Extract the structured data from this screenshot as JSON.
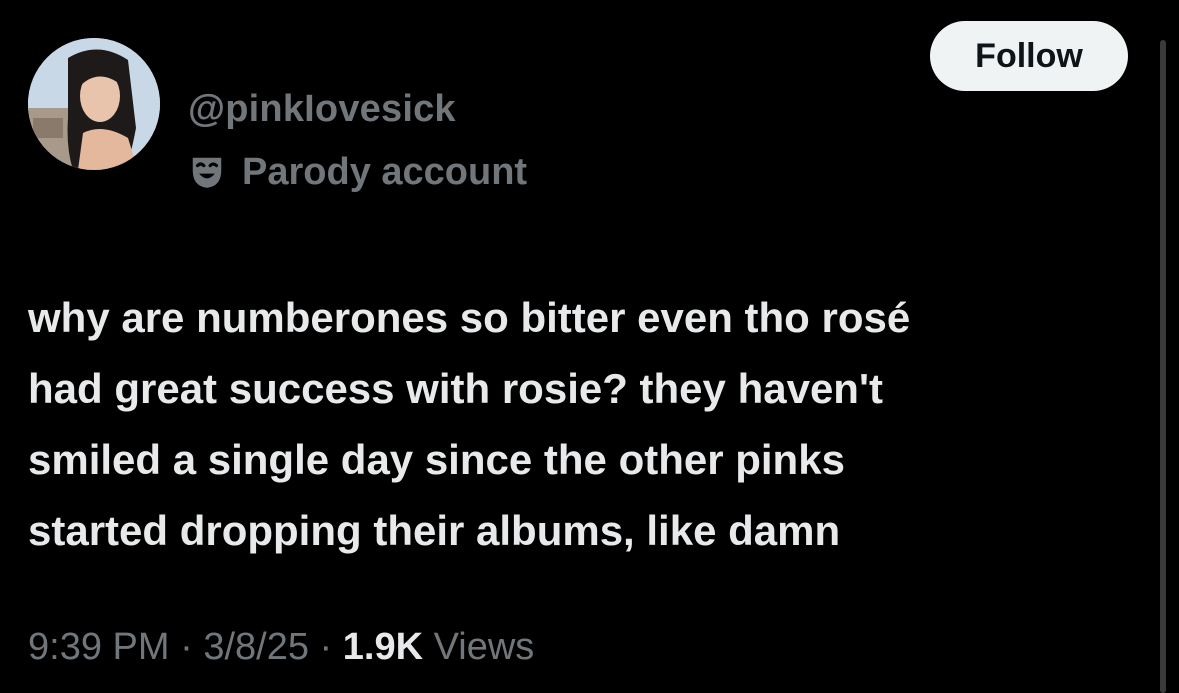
{
  "tweet": {
    "handle": "@pinkIovesick",
    "parody_label": "Parody account",
    "follow_label": "Follow",
    "text_lines": [
      "why are numberones so bitter even tho rosé",
      "had great success with rosie? they haven't",
      "smiled a single day since the other pinks",
      "started dropping their albums, like damn"
    ],
    "time": "9:39 PM",
    "separator": "·",
    "date": "3/8/25",
    "views_count": "1.9K",
    "views_label": "Views"
  },
  "icons": {
    "avatar": "profile-photo",
    "parody": "theater-mask-icon"
  },
  "colors": {
    "background": "#000000",
    "primary_text": "#e7e9ea",
    "secondary_text": "#71767b",
    "follow_bg": "#eff3f4",
    "follow_text": "#0f1419"
  }
}
